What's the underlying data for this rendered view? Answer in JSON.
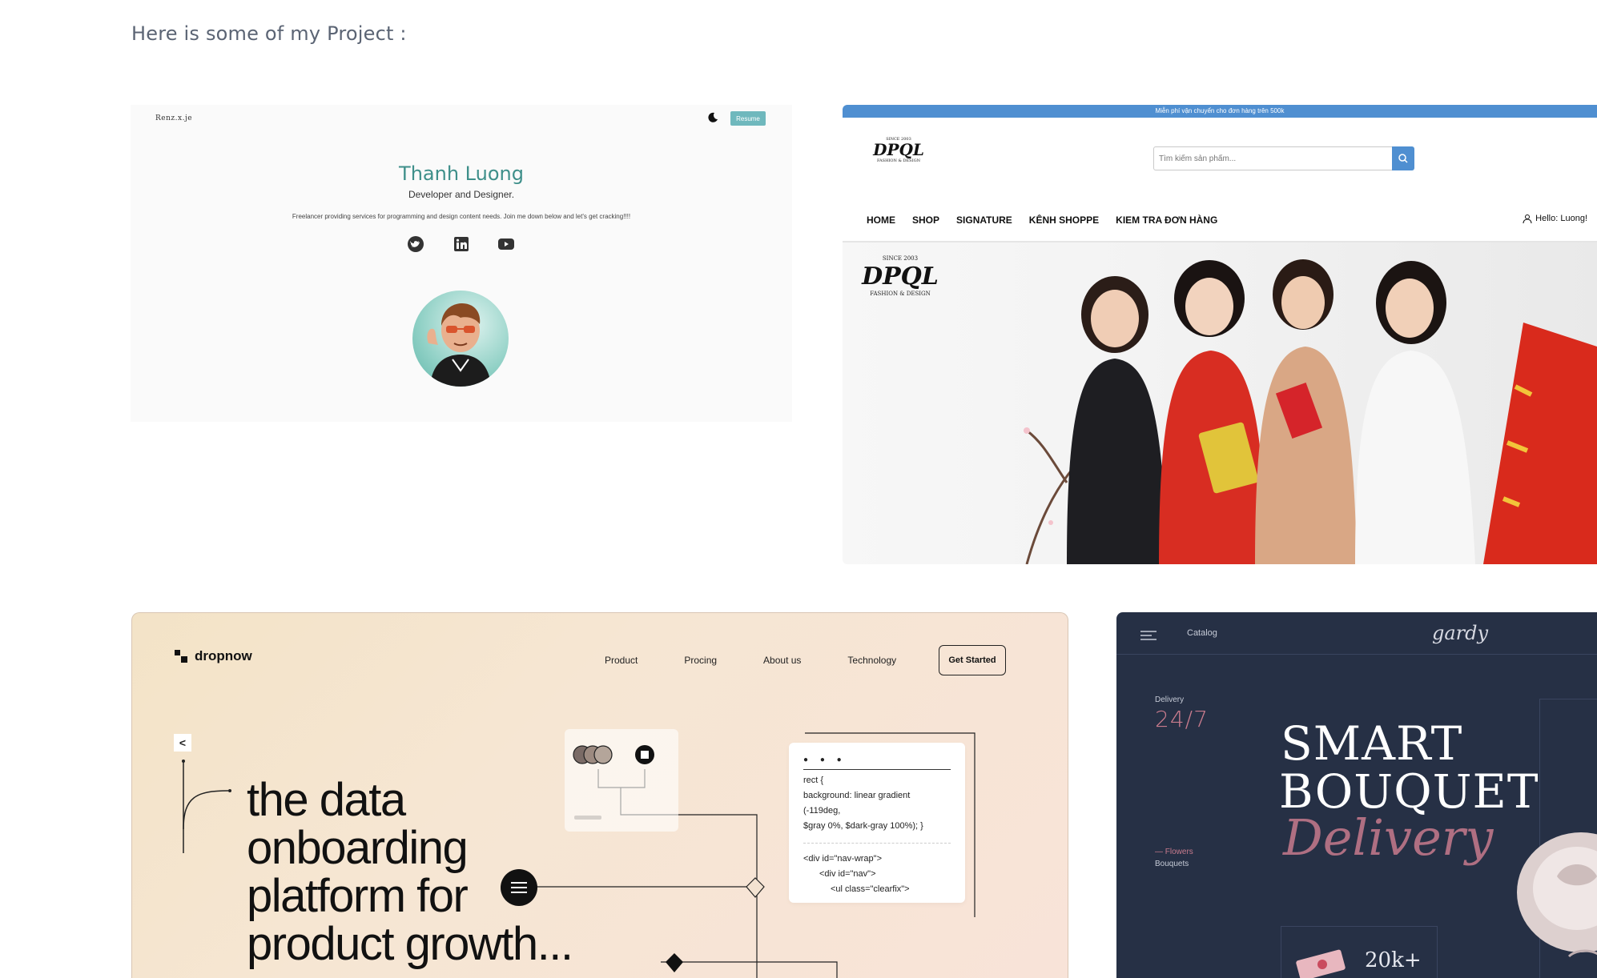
{
  "heading": "Here is some of my Project :",
  "projects": {
    "portfolio": {
      "logo": "Renz.x.je",
      "resume_label": "Resume",
      "name": "Thanh Luong",
      "subtitle": "Developer and Designer.",
      "description": "Freelancer providing services for programming and design content needs. Join me down below and let's get cracking!!!!",
      "socials": [
        "twitter-icon",
        "linkedin-icon",
        "youtube-icon"
      ],
      "accent": "#3e8f8a"
    },
    "shop": {
      "topbar_text": "Miễn phí vận chuyển cho đơn hàng trên 500k",
      "brand": "DPQL",
      "brand_since": "SINCE 2003",
      "brand_tagline": "FASHION & DESIGN",
      "search_placeholder": "Tìm kiếm sản phẩm...",
      "nav": [
        "HOME",
        "SHOP",
        "SIGNATURE",
        "KÊNH SHOPPE",
        "KIEM TRA ĐƠN HÀNG"
      ],
      "greeting": "Hello: Luong!",
      "accent": "#4f8fd1"
    },
    "dropnow": {
      "logo": "dropnow",
      "nav": [
        "Product",
        "Procing",
        "About us",
        "Technology"
      ],
      "cta": "Get Started",
      "back": "<",
      "headline": [
        "the data",
        "onboarding",
        "platform for",
        "product growth..."
      ],
      "code_lines": [
        "rect {",
        "background: linear gradient",
        "(-119deg,",
        "$gray 0%, $dark-gray 100%); }"
      ],
      "code_lines_2": [
        "<div id=\"nav-wrap\">",
        "<div id=\"nav\">",
        "<ul class=\"clearfix\">"
      ]
    },
    "gardy": {
      "catalog": "Catalog",
      "brand": "gardy",
      "delivery_label": "Delivery",
      "delivery_value": "24/7",
      "side_flowers": "— Flowers",
      "side_bouquets": "Bouquets",
      "title_1": "SMART",
      "title_2": "BOUQUET",
      "title_3": "Delivery",
      "count": "20k+",
      "accent": "#c87b8d",
      "background": "#263045"
    }
  }
}
